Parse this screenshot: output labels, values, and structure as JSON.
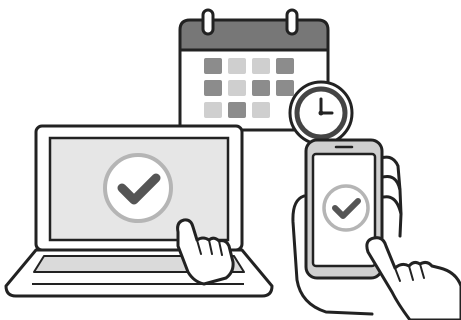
{
  "illustration": {
    "subject": "online-booking-confirmed",
    "elements": [
      "calendar-icon",
      "clock-icon",
      "laptop",
      "smartphone",
      "checkmark-icon",
      "pointing-hand-icon"
    ]
  },
  "colors": {
    "outline": "#222222",
    "background": "#ffffff",
    "screen_fill": "#e6e6e6",
    "calendar_header": "#777777",
    "calendar_cell_dark": "#8c8c8c",
    "calendar_cell_light": "#cfcfcf",
    "check_mark": "#555555",
    "badge_ring": "#b5b5b5",
    "phone_body": "#cfcfcf",
    "keyboard": "#dadada"
  }
}
